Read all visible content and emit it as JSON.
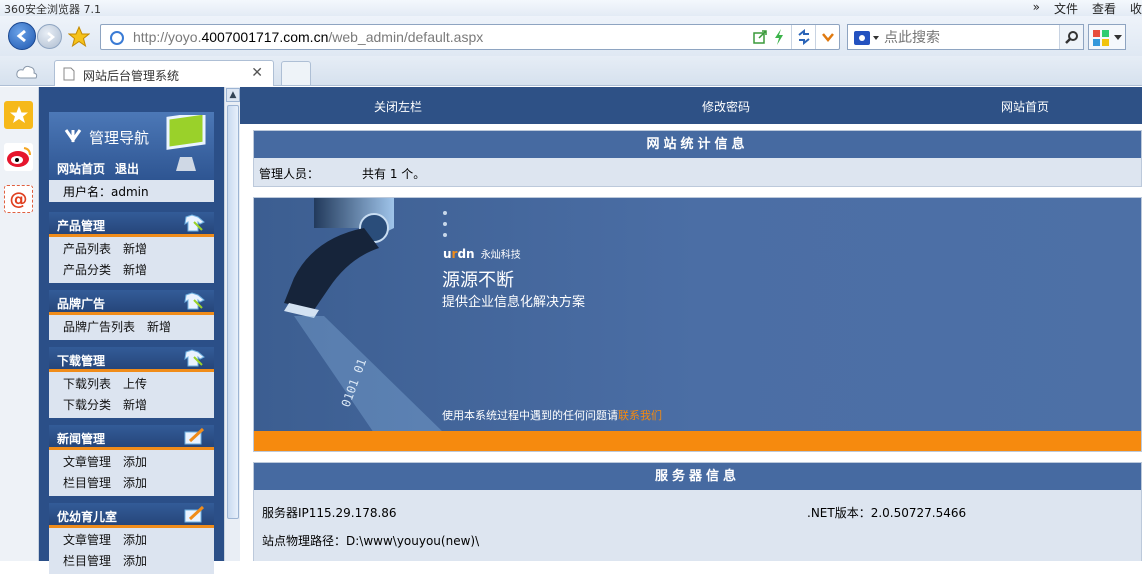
{
  "browser": {
    "title": "360安全浏览器 7.1",
    "menu": [
      "»",
      "文件",
      "查看",
      "收"
    ],
    "url_prefix": "http://yoyo.",
    "url_domain": "4007001717.com.cn",
    "url_path": "/web_admin/default.aspx",
    "search_placeholder": "点此搜索",
    "tab_title": "网站后台管理系统"
  },
  "left_nav": {
    "header": "管理导航",
    "home_link": "网站首页",
    "logout_link": "退出",
    "username": "用户名：admin",
    "groups": [
      {
        "title": "产品管理",
        "rows": [
          [
            "产品列表",
            "新增"
          ],
          [
            "产品分类",
            "新增"
          ]
        ]
      },
      {
        "title": "品牌广告",
        "rows": [
          [
            "品牌广告列表",
            "新增"
          ]
        ]
      },
      {
        "title": "下载管理",
        "rows": [
          [
            "下载列表",
            "上传"
          ],
          [
            "下载分类",
            "新增"
          ]
        ]
      },
      {
        "title": "新闻管理",
        "rows": [
          [
            "文章管理",
            "添加"
          ],
          [
            "栏目管理",
            "添加"
          ]
        ]
      },
      {
        "title": "优幼育儿室",
        "rows": [
          [
            "文章管理",
            "添加"
          ],
          [
            "栏目管理",
            "添加"
          ]
        ]
      }
    ]
  },
  "top_nav": {
    "close_left": "关闭左栏",
    "change_pwd": "修改密码",
    "site_home": "网站首页"
  },
  "stats": {
    "title": "网站统计信息",
    "label": "管理人员：",
    "value": "共有 1 个。"
  },
  "banner": {
    "brand": "永灿科技",
    "slogan": "源源不断",
    "subtitle": "提供企业信息化解决方案",
    "help_text": "使用本系统过程中遇到的任何问题请",
    "contact_link": "联系我们"
  },
  "server": {
    "title": "服务器信息",
    "ip": "服务器IP115.29.178.86",
    "net_version": ".NET版本：2.0.50727.5466",
    "path": "站点物理路径：D:\\www\\youyou(new)\\"
  },
  "colors": {
    "nav_bg": "#2b4f88",
    "header_bg": "#466aa1",
    "accent": "#f08c1a"
  }
}
